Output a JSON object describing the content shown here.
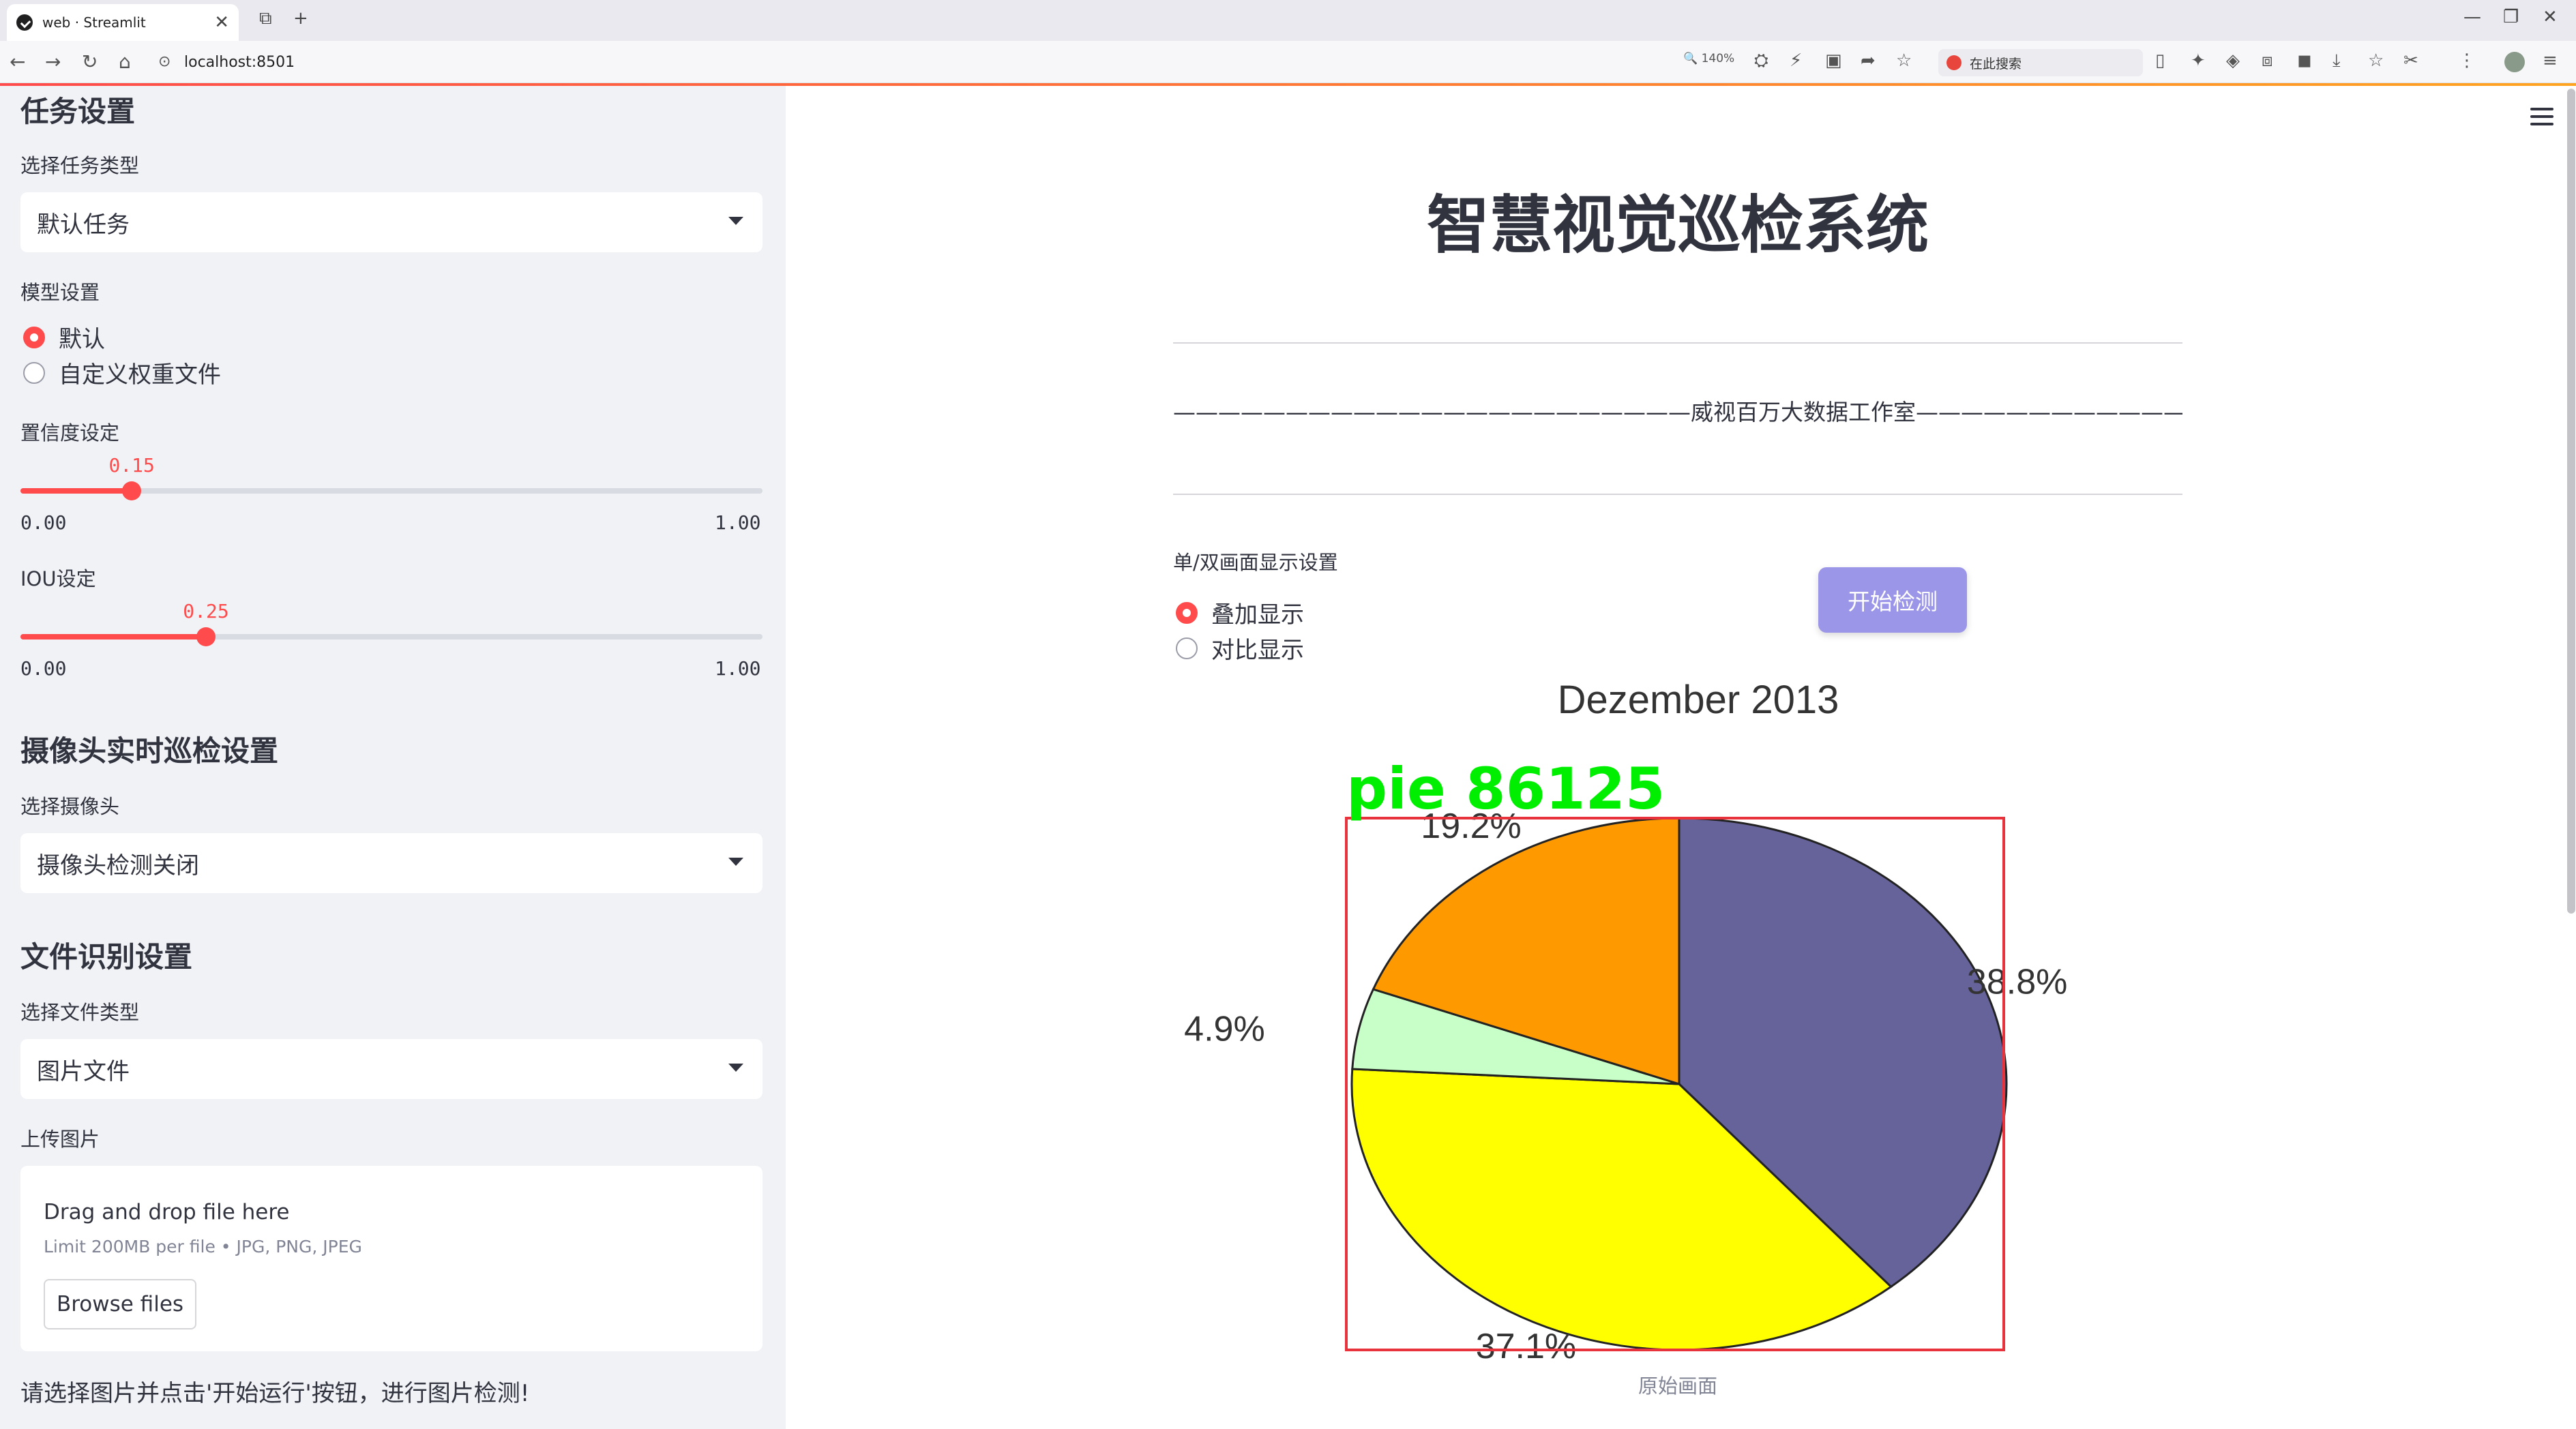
{
  "browser": {
    "tab_title": "web · Streamlit",
    "tab_close": "✕",
    "new_tab": "+",
    "url": "localhost:8501",
    "zoom": "140%",
    "search_placeholder": "在此搜索",
    "icons": [
      "back-arrow-icon",
      "forward-arrow-icon",
      "reload-icon",
      "home-icon",
      "zoom-icon",
      "extensions-icon",
      "bookmark-star-icon",
      "download-icon",
      "more-icon"
    ]
  },
  "sidebar": {
    "task_heading": "任务设置",
    "task_type_label": "选择任务类型",
    "task_type_value": "默认任务",
    "model_label": "模型设置",
    "model_options": [
      "默认",
      "自定义权重文件"
    ],
    "model_selected": 0,
    "conf_label": "置信度设定",
    "conf_value": "0.15",
    "conf_fraction": 0.15,
    "conf_min": "0.00",
    "conf_max": "1.00",
    "iou_label": "IOU设定",
    "iou_value": "0.25",
    "iou_fraction": 0.25,
    "iou_min": "0.00",
    "iou_max": "1.00",
    "camera_heading": "摄像头实时巡检设置",
    "camera_label": "选择摄像头",
    "camera_value": "摄像头检测关闭",
    "file_heading": "文件识别设置",
    "file_type_label": "选择文件类型",
    "file_type_value": "图片文件",
    "upload_label": "上传图片",
    "upload_title": "Drag and drop file here",
    "upload_limit": "Limit 200MB per file • JPG, PNG, JPEG",
    "browse_label": "Browse files",
    "note": "请选择图片并点击'开始运行'按钮，进行图片检测!"
  },
  "main": {
    "title": "智慧视觉巡检系统",
    "studio_line": "———————————————————————威视百万大数据工作室————————————————————————",
    "display_label": "单/双画面显示设置",
    "display_options": [
      "叠加显示",
      "对比显示"
    ],
    "display_selected": 0,
    "start_button": "开始检测",
    "caption": "原始画面"
  },
  "chart_data": {
    "type": "pie",
    "title": "Dezember 2013",
    "slices": [
      {
        "label": "38.8%",
        "value": 38.8,
        "color": "#66639a"
      },
      {
        "label": "37.1%",
        "value": 37.1,
        "color": "#ffff00"
      },
      {
        "label": "4.9%",
        "value": 4.9,
        "color": "#c8ffc8"
      },
      {
        "label": "19.2%",
        "value": 19.2,
        "color": "#ff9900"
      }
    ]
  },
  "detection": {
    "label": "pie",
    "score": "86125",
    "box_color": "#e8333c",
    "label_color": "#00ee00"
  }
}
